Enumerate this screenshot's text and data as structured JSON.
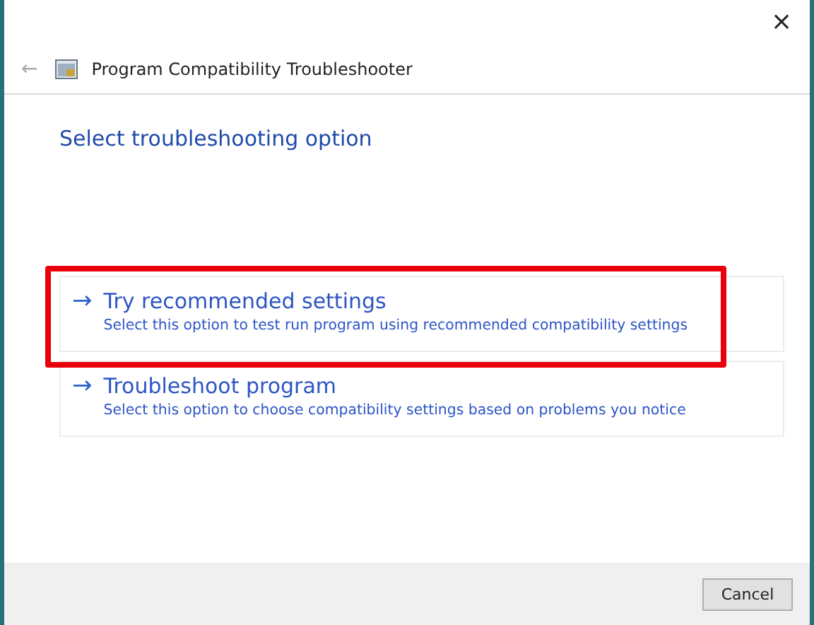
{
  "window": {
    "close": "×",
    "back": "←",
    "title": "Program Compatibility Troubleshooter"
  },
  "heading": "Select troubleshooting option",
  "options": [
    {
      "arrow": "→",
      "title": "Try recommended settings",
      "description": "Select this option to test run program using recommended compatibility settings",
      "highlighted": true
    },
    {
      "arrow": "→",
      "title": "Troubleshoot program",
      "description": "Select this option to choose compatibility settings based on problems you notice",
      "highlighted": false
    }
  ],
  "buttons": [
    "Cancel"
  ]
}
